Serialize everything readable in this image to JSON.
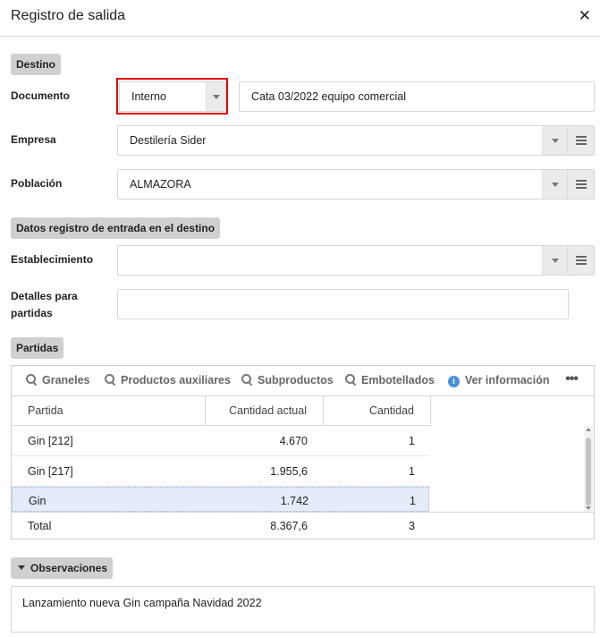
{
  "window": {
    "title": "Registro de salida",
    "close_glyph": "✕"
  },
  "sections": {
    "destino": "Destino",
    "datos_registro": "Datos registro de entrada en el destino",
    "partidas": "Partidas",
    "observaciones": "Observaciones"
  },
  "form": {
    "documento": {
      "label": "Documento",
      "type_value": "Interno",
      "text_value": "Cata 03/2022 equipo comercial"
    },
    "empresa": {
      "label": "Empresa",
      "value": "Destilería Sider"
    },
    "poblacion": {
      "label": "Población",
      "value": "ALMAZORA"
    },
    "establecimiento": {
      "label": "Establecimiento",
      "value": ""
    },
    "detalles": {
      "label_line1": "Detalles para",
      "label_line2": "partidas",
      "value": ""
    }
  },
  "toolbar": {
    "items": [
      "Graneles",
      "Productos auxiliares",
      "Subproductos",
      "Embotellados",
      "Ver información"
    ],
    "more": "•••"
  },
  "table": {
    "columns": [
      "Partida",
      "Cantidad actual",
      "Cantidad"
    ],
    "rows": [
      {
        "partida": "Gin [212]",
        "cantidad_actual": "4.670",
        "cantidad": "1"
      },
      {
        "partida": "Gin [217]",
        "cantidad_actual": "1.955,6",
        "cantidad": "1"
      },
      {
        "partida": "Gin",
        "cantidad_actual": "1.742",
        "cantidad": "1"
      }
    ],
    "total": {
      "label": "Total",
      "cantidad_actual": "8.367,6",
      "cantidad": "3"
    }
  },
  "observaciones_text": "Lanzamiento nueva Gin campaña Navidad 2022",
  "colors": {
    "highlight_border": "#e00000",
    "selected_row": "#e3ecf8",
    "info_icon": "#4a90d9"
  }
}
